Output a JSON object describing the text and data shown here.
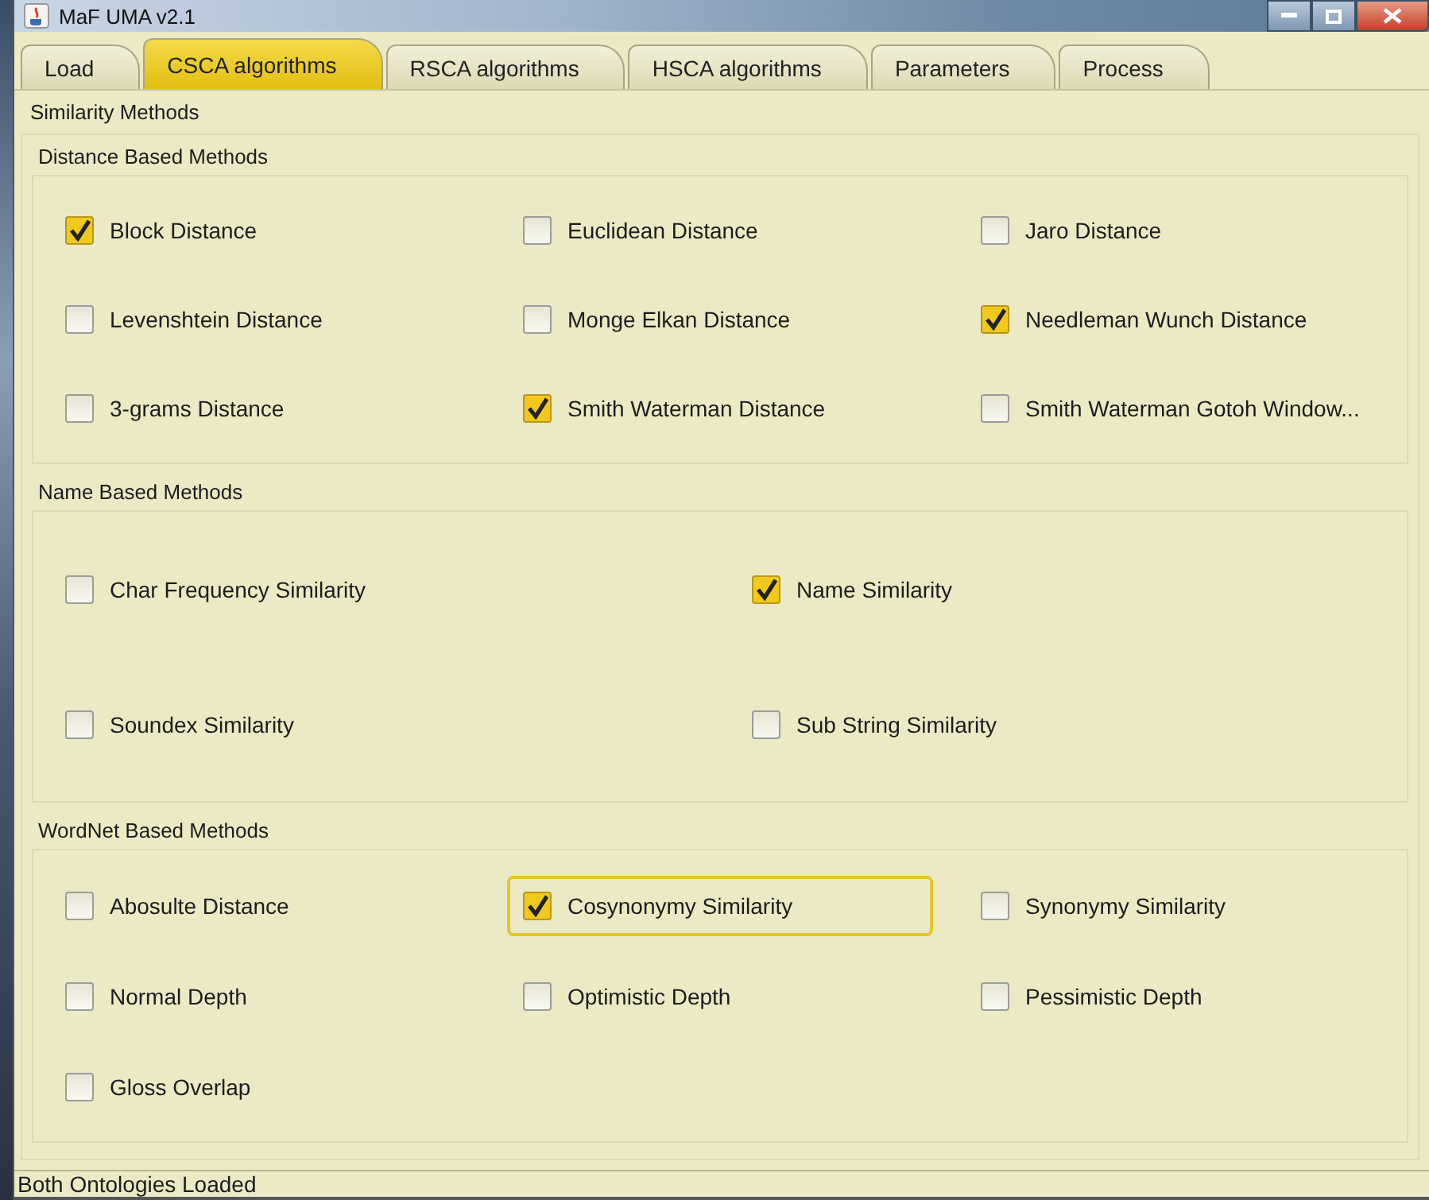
{
  "window": {
    "title": "MaF UMA v2.1"
  },
  "tabs": [
    {
      "label": "Load",
      "selected": false
    },
    {
      "label": "CSCA algorithms",
      "selected": true
    },
    {
      "label": "RSCA algorithms",
      "selected": false
    },
    {
      "label": "HSCA algorithms",
      "selected": false
    },
    {
      "label": "Parameters",
      "selected": false
    },
    {
      "label": "Process",
      "selected": false
    }
  ],
  "panel_title": "Similarity Methods",
  "groups": [
    {
      "title": "Distance Based Methods",
      "items": [
        {
          "label": "Block Distance",
          "checked": true,
          "focused": false
        },
        {
          "label": "Euclidean Distance",
          "checked": false,
          "focused": false
        },
        {
          "label": "Jaro Distance",
          "checked": false,
          "focused": false
        },
        {
          "label": "Levenshtein Distance",
          "checked": false,
          "focused": false
        },
        {
          "label": "Monge Elkan Distance",
          "checked": false,
          "focused": false
        },
        {
          "label": "Needleman Wunch Distance",
          "checked": true,
          "focused": false
        },
        {
          "label": "3-grams Distance",
          "checked": false,
          "focused": false
        },
        {
          "label": "Smith Waterman Distance",
          "checked": true,
          "focused": false
        },
        {
          "label": "Smith Waterman Gotoh Window...",
          "checked": false,
          "focused": false
        }
      ]
    },
    {
      "title": "Name Based Methods",
      "items": [
        {
          "label": "Char Frequency Similarity",
          "checked": false,
          "focused": false
        },
        {
          "label": "Name Similarity",
          "checked": true,
          "focused": false
        },
        {
          "label": "Soundex Similarity",
          "checked": false,
          "focused": false
        },
        {
          "label": "Sub String Similarity",
          "checked": false,
          "focused": false
        }
      ]
    },
    {
      "title": "WordNet Based Methods",
      "items": [
        {
          "label": "Abosulte Distance",
          "checked": false,
          "focused": false
        },
        {
          "label": "Cosynonymy Similarity",
          "checked": true,
          "focused": true
        },
        {
          "label": "Synonymy Similarity",
          "checked": false,
          "focused": false
        },
        {
          "label": "Normal Depth",
          "checked": false,
          "focused": false
        },
        {
          "label": "Optimistic Depth",
          "checked": false,
          "focused": false
        },
        {
          "label": "Pessimistic Depth",
          "checked": false,
          "focused": false
        },
        {
          "label": "Gloss Overlap",
          "checked": false,
          "focused": false
        }
      ]
    }
  ],
  "status_bar": "Both Ontologies Loaded"
}
